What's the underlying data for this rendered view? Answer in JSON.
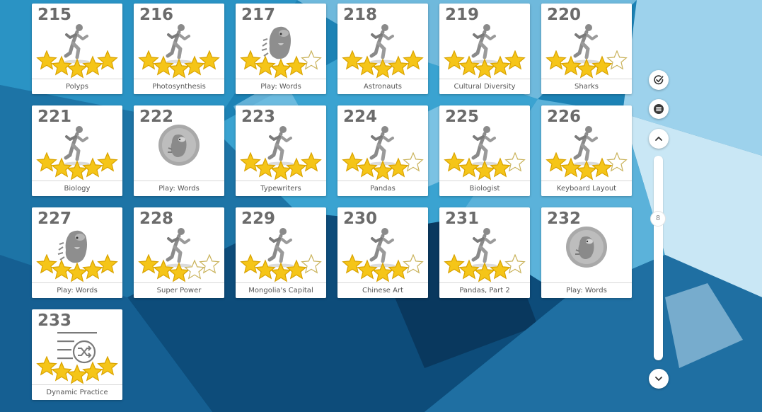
{
  "lessons": [
    {
      "number": "215",
      "label": "Polyps",
      "icon": "runner-icon",
      "stars": 5
    },
    {
      "number": "216",
      "label": "Photosynthesis",
      "icon": "runner-icon",
      "stars": 5
    },
    {
      "number": "217",
      "label": "Play: Words",
      "icon": "mascot-icon",
      "stars": 4
    },
    {
      "number": "218",
      "label": "Astronauts",
      "icon": "runner-icon",
      "stars": 5
    },
    {
      "number": "219",
      "label": "Cultural Diversity",
      "icon": "runner-icon",
      "stars": 5
    },
    {
      "number": "220",
      "label": "Sharks",
      "icon": "runner-icon",
      "stars": 4
    },
    {
      "number": "221",
      "label": "Biology",
      "icon": "runner-icon",
      "stars": 5
    },
    {
      "number": "222",
      "label": "Play: Words",
      "icon": "locked-mascot-icon",
      "stars": 0
    },
    {
      "number": "223",
      "label": "Typewriters",
      "icon": "runner-icon",
      "stars": 5
    },
    {
      "number": "224",
      "label": "Pandas",
      "icon": "runner-icon",
      "stars": 4
    },
    {
      "number": "225",
      "label": "Biologist",
      "icon": "runner-icon",
      "stars": 4
    },
    {
      "number": "226",
      "label": "Keyboard Layout",
      "icon": "runner-icon",
      "stars": 4
    },
    {
      "number": "227",
      "label": "Play: Words",
      "icon": "mascot-icon",
      "stars": 5
    },
    {
      "number": "228",
      "label": "Super Power",
      "icon": "runner-icon",
      "stars": 3
    },
    {
      "number": "229",
      "label": "Mongolia's Capital",
      "icon": "runner-icon",
      "stars": 4
    },
    {
      "number": "230",
      "label": "Chinese Art",
      "icon": "runner-icon",
      "stars": 4
    },
    {
      "number": "231",
      "label": "Pandas, Part 2",
      "icon": "runner-icon",
      "stars": 4
    },
    {
      "number": "232",
      "label": "Play: Words",
      "icon": "locked-mascot-icon",
      "stars": 0
    },
    {
      "number": "233",
      "label": "Dynamic Practice",
      "icon": "shuffle-list-icon",
      "stars": 5
    }
  ],
  "sidebar": {
    "check_icon": "check-circle-icon",
    "menu_icon": "list-menu-icon",
    "up_icon": "chevron-up-icon",
    "down_icon": "chevron-down-icon",
    "scroll_position_label": "8"
  },
  "colors": {
    "background": "#1c7fb0",
    "star_fill": "#f5c518",
    "star_outline": "#c9b25a",
    "card": "#ffffff",
    "number_text": "#6b6b6b"
  }
}
